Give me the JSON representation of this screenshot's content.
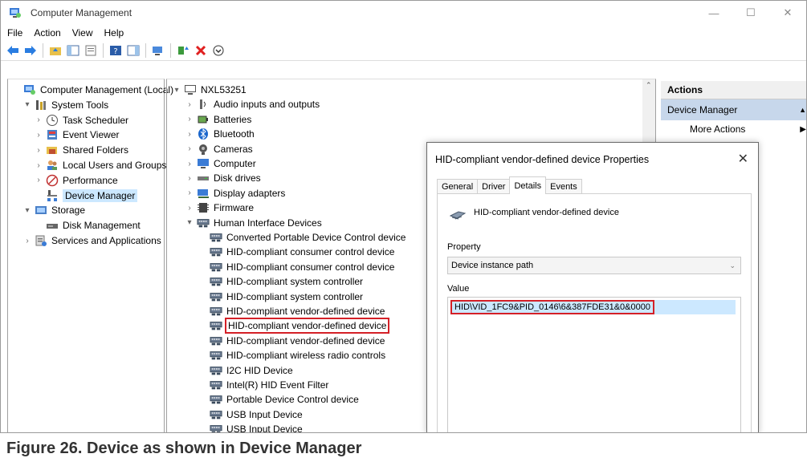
{
  "window": {
    "title": "Computer Management",
    "min": "—",
    "max": "☐",
    "close": "✕"
  },
  "menu": [
    "File",
    "Action",
    "View",
    "Help"
  ],
  "left_tree": [
    {
      "label": "Computer Management (Local)",
      "indent": 0,
      "arrow": "",
      "icon": "computer-management-icon"
    },
    {
      "label": "System Tools",
      "indent": 1,
      "arrow": "▾",
      "icon": "system-tools-icon"
    },
    {
      "label": "Task Scheduler",
      "indent": 2,
      "arrow": "›",
      "icon": "clock-icon"
    },
    {
      "label": "Event Viewer",
      "indent": 2,
      "arrow": "›",
      "icon": "event-viewer-icon"
    },
    {
      "label": "Shared Folders",
      "indent": 2,
      "arrow": "›",
      "icon": "shared-folder-icon"
    },
    {
      "label": "Local Users and Groups",
      "indent": 2,
      "arrow": "›",
      "icon": "users-icon"
    },
    {
      "label": "Performance",
      "indent": 2,
      "arrow": "›",
      "icon": "performance-icon"
    },
    {
      "label": "Device Manager",
      "indent": 2,
      "arrow": "",
      "icon": "device-manager-icon",
      "selected": true
    },
    {
      "label": "Storage",
      "indent": 1,
      "arrow": "▾",
      "icon": "storage-icon"
    },
    {
      "label": "Disk Management",
      "indent": 2,
      "arrow": "",
      "icon": "disk-icon"
    },
    {
      "label": "Services and Applications",
      "indent": 1,
      "arrow": "›",
      "icon": "services-icon"
    }
  ],
  "device_tree": [
    {
      "label": "NXL53251",
      "level": 0,
      "arrow": "▾",
      "icon": "computer-icon"
    },
    {
      "label": "Audio inputs and outputs",
      "level": 1,
      "arrow": "›",
      "icon": "audio-icon"
    },
    {
      "label": "Batteries",
      "level": 1,
      "arrow": "›",
      "icon": "battery-icon"
    },
    {
      "label": "Bluetooth",
      "level": 1,
      "arrow": "›",
      "icon": "bluetooth-icon"
    },
    {
      "label": "Cameras",
      "level": 1,
      "arrow": "›",
      "icon": "camera-icon"
    },
    {
      "label": "Computer",
      "level": 1,
      "arrow": "›",
      "icon": "monitor-icon"
    },
    {
      "label": "Disk drives",
      "level": 1,
      "arrow": "›",
      "icon": "disk-drive-icon"
    },
    {
      "label": "Display adapters",
      "level": 1,
      "arrow": "›",
      "icon": "display-adapter-icon"
    },
    {
      "label": "Firmware",
      "level": 1,
      "arrow": "›",
      "icon": "firmware-icon"
    },
    {
      "label": "Human Interface Devices",
      "level": 1,
      "arrow": "▾",
      "icon": "hid-icon"
    },
    {
      "label": "Converted Portable Device Control device",
      "level": 2,
      "arrow": "",
      "icon": "hid-icon"
    },
    {
      "label": "HID-compliant consumer control device",
      "level": 2,
      "arrow": "",
      "icon": "hid-icon"
    },
    {
      "label": "HID-compliant consumer control device",
      "level": 2,
      "arrow": "",
      "icon": "hid-icon"
    },
    {
      "label": "HID-compliant system controller",
      "level": 2,
      "arrow": "",
      "icon": "hid-icon"
    },
    {
      "label": "HID-compliant system controller",
      "level": 2,
      "arrow": "",
      "icon": "hid-icon"
    },
    {
      "label": "HID-compliant vendor-defined device",
      "level": 2,
      "arrow": "",
      "icon": "hid-icon"
    },
    {
      "label": "HID-compliant vendor-defined device",
      "level": 2,
      "arrow": "",
      "icon": "hid-icon",
      "highlight": true
    },
    {
      "label": "HID-compliant vendor-defined device",
      "level": 2,
      "arrow": "",
      "icon": "hid-icon"
    },
    {
      "label": "HID-compliant wireless radio controls",
      "level": 2,
      "arrow": "",
      "icon": "hid-icon"
    },
    {
      "label": "I2C HID Device",
      "level": 2,
      "arrow": "",
      "icon": "hid-icon"
    },
    {
      "label": "Intel(R) HID Event Filter",
      "level": 2,
      "arrow": "",
      "icon": "hid-icon"
    },
    {
      "label": "Portable Device Control device",
      "level": 2,
      "arrow": "",
      "icon": "hid-icon"
    },
    {
      "label": "USB Input Device",
      "level": 2,
      "arrow": "",
      "icon": "hid-icon"
    },
    {
      "label": "USB Input Device",
      "level": 2,
      "arrow": "",
      "icon": "hid-icon"
    }
  ],
  "actions": {
    "header": "Actions",
    "selected": "Device Manager",
    "item": "More Actions"
  },
  "dialog": {
    "title": "HID-compliant vendor-defined device Properties",
    "tabs": [
      "General",
      "Driver",
      "Details",
      "Events"
    ],
    "active_tab": "Details",
    "device_name": "HID-compliant vendor-defined device",
    "property_label": "Property",
    "property_value": "Device instance path",
    "value_label": "Value",
    "value": "HID\\VID_1FC9&PID_0146\\6&387FDE31&0&0000"
  },
  "caption": "Figure 26.  Device as shown in Device Manager",
  "colors": {
    "selection": "#cce8ff",
    "highlight": "#d42027",
    "actions_selected": "#c7d7eb"
  }
}
